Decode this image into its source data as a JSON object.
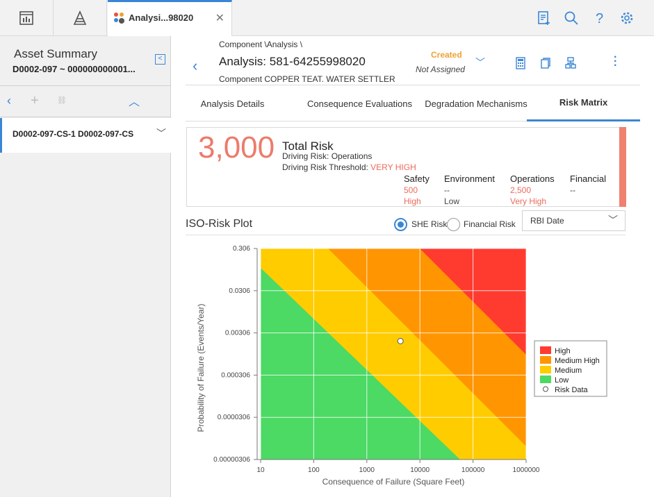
{
  "topbar": {
    "tab_title": "Analysi...98020",
    "icons": [
      "dashboard-icon",
      "hierarchy-icon",
      "app-tab-icon",
      "close-icon",
      "clipboard-add-icon",
      "search-icon",
      "help-icon",
      "gear-icon"
    ]
  },
  "left_panel": {
    "title": "Asset Summary",
    "subtitle": "D0002-097 ~ 000000000001...",
    "collapse_icon": "collapse-left-icon",
    "tools": [
      "back-icon",
      "add-icon",
      "link-icon",
      "chevron-up-icon"
    ],
    "item_label": "D0002-097-CS-1 D0002-097-CS"
  },
  "header": {
    "breadcrumb": "Component \\Analysis \\",
    "title": "Analysis: 581-64255998020",
    "component_label": "Component",
    "component_value": "COPPER TEAT. WATER SETTLER",
    "status": "Created",
    "assigned": "Not Assigned",
    "status_color": "#f0a030",
    "action_icons": [
      "calculator-icon",
      "copy-icon",
      "flowchart-icon",
      "more-vertical-icon"
    ]
  },
  "tabs": [
    {
      "label": "Analysis Details"
    },
    {
      "label": "Consequence Evaluations"
    },
    {
      "label": "Degradation Mechanisms"
    },
    {
      "label": "Risk Matrix"
    }
  ],
  "risk_summary": {
    "total_value": "3,000",
    "total_label": "Total Risk",
    "driving_risk_label": "Driving Risk:",
    "driving_risk_value": "Operations",
    "threshold_label": "Driving Risk Threshold:",
    "threshold_value": "VERY HIGH",
    "categories": [
      {
        "name": "Safety",
        "value": "500",
        "level": "High"
      },
      {
        "name": "Environment",
        "value": "--",
        "level": "Low"
      },
      {
        "name": "Operations",
        "value": "2,500",
        "level": "Very High"
      },
      {
        "name": "Financial",
        "value": "--",
        "level": ""
      }
    ],
    "accent_color": "#f08070"
  },
  "iso_plot": {
    "title": "ISO-Risk Plot",
    "radio_she": "SHE Risk",
    "radio_financial": "Financial Risk",
    "selected": "SHE Risk",
    "date_select": "RBI Date"
  },
  "chart_data": {
    "type": "scatter",
    "title": "",
    "xlabel": "Consequence of Failure (Square Feet)",
    "ylabel": "Probability of Failure (Events/Year)",
    "x_scale": "log",
    "y_scale": "log",
    "x_ticks": [
      "10",
      "100",
      "1000",
      "10000",
      "100000",
      "1000000"
    ],
    "y_ticks": [
      "0.306",
      "0.0306",
      "0.00306",
      "0.000306",
      "0.0000306",
      "0.00000306"
    ],
    "xlim": [
      10,
      1000000
    ],
    "ylim": [
      3.06e-06,
      0.306
    ],
    "regions": [
      {
        "name": "Low",
        "color": "#4cd964"
      },
      {
        "name": "Medium",
        "color": "#ffcc00"
      },
      {
        "name": "Medium High",
        "color": "#ff9500"
      },
      {
        "name": "High",
        "color": "#ff3b30"
      }
    ],
    "series": [
      {
        "name": "Risk Data",
        "points": [
          {
            "x": 4300,
            "y": 0.00196
          }
        ]
      }
    ],
    "legend": [
      "High",
      "Medium High",
      "Medium",
      "Low",
      "Risk Data"
    ],
    "legend_position": "right",
    "grid": true
  }
}
